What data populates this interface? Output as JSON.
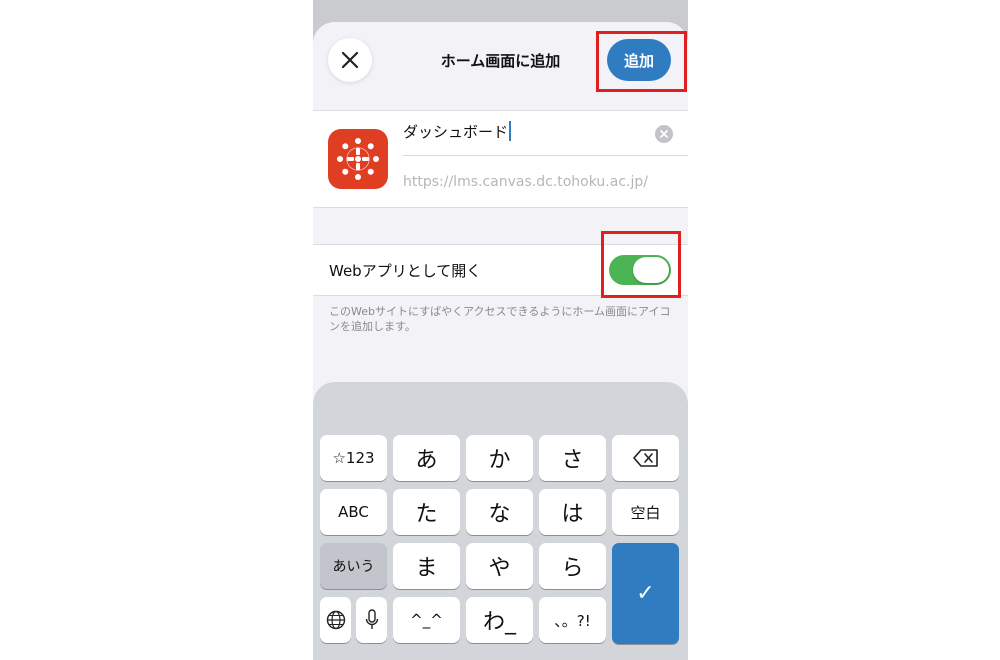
{
  "header": {
    "close_icon": "close-icon",
    "title": "ホーム画面に追加",
    "add_label": "追加"
  },
  "info": {
    "app_icon": "canvas-logo-icon",
    "name_value": "ダッシュボード",
    "url": "https://lms.canvas.dc.tohoku.ac.jp/"
  },
  "toggle": {
    "label": "Webアプリとして開く",
    "on": true
  },
  "footnote": "このWebサイトにすばやくアクセスできるようにホーム画面にアイコンを追加します。",
  "keyboard": {
    "row1": [
      "☆123",
      "あ",
      "か",
      "さ"
    ],
    "row2": [
      "ABC",
      "た",
      "な",
      "は",
      "空白"
    ],
    "row3": [
      "あいう",
      "ま",
      "や",
      "ら"
    ],
    "row4": [
      "^_^",
      "わ_",
      "、。?!"
    ],
    "enter_symbol": "✓",
    "icons": [
      "backspace-icon",
      "globe-icon",
      "microphone-icon"
    ]
  },
  "colors": {
    "accent": "#2f7cc1",
    "toggle_on": "#4cb454",
    "highlight": "#e02020",
    "app_icon_bg": "#e03e22"
  }
}
